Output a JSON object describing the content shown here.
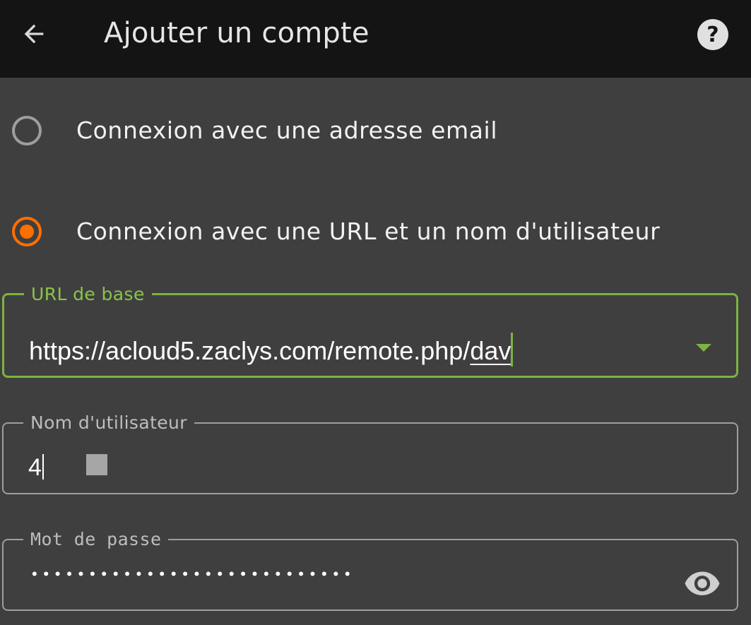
{
  "appbar": {
    "title": "Ajouter un compte",
    "back_icon": "arrow-left-icon",
    "help_icon": "help-circle-icon"
  },
  "login_options": [
    {
      "label": "Connexion avec une adresse email",
      "selected": false
    },
    {
      "label": "Connexion avec une URL et un nom d'utilisateur",
      "selected": true
    }
  ],
  "base_url": {
    "label": "URL de base",
    "value_prefix": "https://acloud5.zaclys.com/remote.php/",
    "value_underlined": "dav",
    "dropdown_icon": "dropdown-arrow-icon"
  },
  "username": {
    "label": "Nom d'utilisateur",
    "value": "4"
  },
  "password": {
    "label": "Mot de passe",
    "mask": "••••••••••••••••••••••••••••",
    "toggle_icon": "eye-icon"
  },
  "colors": {
    "accent_orange": "#ff6f00",
    "focus_green": "#7cb342",
    "appbar_bg": "#141414",
    "page_bg": "#3f3f3f"
  }
}
